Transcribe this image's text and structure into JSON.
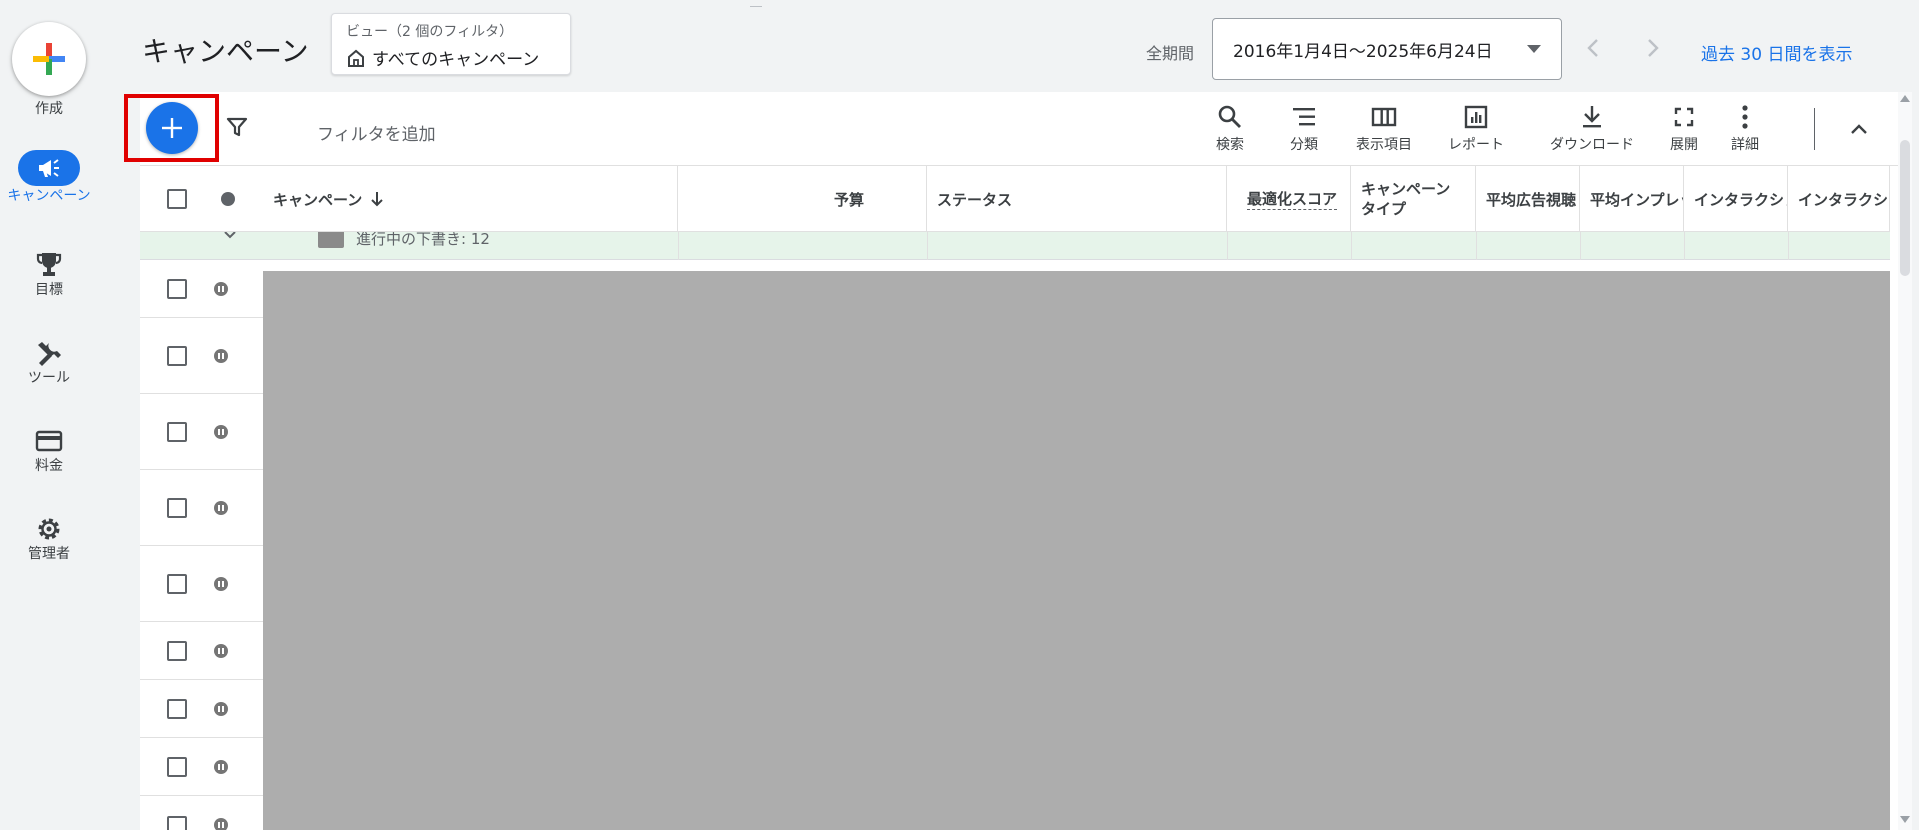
{
  "nav": {
    "create_label": "作成",
    "items": [
      {
        "label": "キャンペーン",
        "icon": "megaphone-icon",
        "active": true
      },
      {
        "label": "目標",
        "icon": "trophy-icon"
      },
      {
        "label": "ツール",
        "icon": "tools-icon"
      },
      {
        "label": "料金",
        "icon": "credit-card-icon"
      },
      {
        "label": "管理者",
        "icon": "gear-icon"
      }
    ]
  },
  "header": {
    "title": "キャンペーン",
    "view": {
      "sub": "ビュー（2 個のフィルタ）",
      "main": "すべてのキャンペーン"
    },
    "period_label": "全期間",
    "date_range": "2016年1月4日～2025年6月24日",
    "recent_link": "過去 30 日間を表示"
  },
  "toolbar": {
    "add_filter": "フィルタを追加",
    "tools": [
      {
        "label": "検索",
        "icon": "search-icon"
      },
      {
        "label": "分類",
        "icon": "segment-icon"
      },
      {
        "label": "表示項目",
        "icon": "columns-icon"
      },
      {
        "label": "レポート",
        "icon": "report-icon"
      },
      {
        "label": "ダウンロード",
        "icon": "download-icon"
      },
      {
        "label": "展開",
        "icon": "expand-icon"
      },
      {
        "label": "詳細",
        "icon": "more-vert-icon"
      }
    ]
  },
  "table": {
    "columns": {
      "campaign": "キャンペーン",
      "budget": "予算",
      "status": "ステータス",
      "opt_score": "最適化スコア",
      "campaign_type": "キャンペーン タイプ",
      "avg_view": "平均広告視聴",
      "avg_imp": "平均インプレッション",
      "interaction1": "インタラクション",
      "interaction2": "インタラクション"
    },
    "group_label": "進行中の下書き: 12",
    "row_count": 9
  },
  "colors": {
    "accent": "#1a73e8",
    "highlight": "#e00000",
    "group_bg": "#e6f4ea",
    "redacted": "#adadad"
  }
}
